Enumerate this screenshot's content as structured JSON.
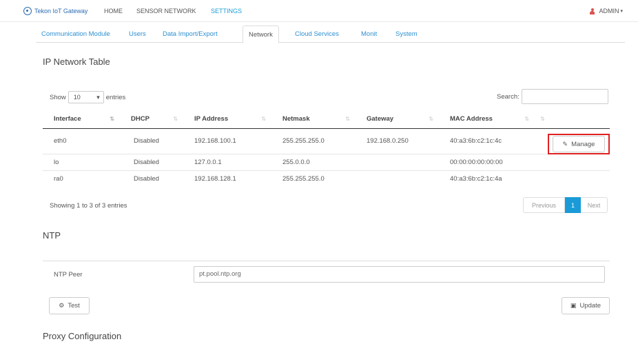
{
  "nav": {
    "brand": "Tekon IoT Gateway",
    "links": [
      "HOME",
      "SENSOR NETWORK",
      "SETTINGS"
    ],
    "user": "ADMIN",
    "caret": "▾"
  },
  "tabs": [
    "Communication Module",
    "Users",
    "Data Import/Export",
    "Network",
    "Cloud Services",
    "Monit",
    "System"
  ],
  "ip_table": {
    "title": "IP Network Table",
    "show_label": "Show",
    "page_size": "10",
    "entries_label": "entries",
    "search_label": "Search:",
    "columns": [
      "Interface",
      "DHCP",
      "IP Address",
      "Netmask",
      "Gateway",
      "MAC Address"
    ],
    "rows": [
      [
        "eth0",
        "Disabled",
        "192.168.100.1",
        "255.255.255.0",
        "192.168.0.250",
        "40:a3:6b:c2:1c:4c"
      ],
      [
        "lo",
        "Disabled",
        "127.0.0.1",
        "255.0.0.0",
        "",
        "00:00:00:00:00:00"
      ],
      [
        "ra0",
        "Disabled",
        "192.168.128.1",
        "255.255.255.0",
        "",
        "40:a3:6b:c2:1c:4a"
      ]
    ],
    "manage_label": "Manage",
    "info": "Showing 1 to 3 of 3 entries",
    "pagination": {
      "previous": "Previous",
      "current": "1",
      "next": "Next"
    }
  },
  "ntp": {
    "title": "NTP",
    "peer_label": "NTP Peer",
    "peer_value": "pt.pool.ntp.org",
    "test_label": "Test",
    "update_label": "Update"
  },
  "proxy": {
    "title": "Proxy Configuration"
  },
  "colors": {
    "accent": "#1a9bd7",
    "brand": "#2c6cb3",
    "highlight": "#e02020",
    "user_icon": "#d9534f"
  }
}
